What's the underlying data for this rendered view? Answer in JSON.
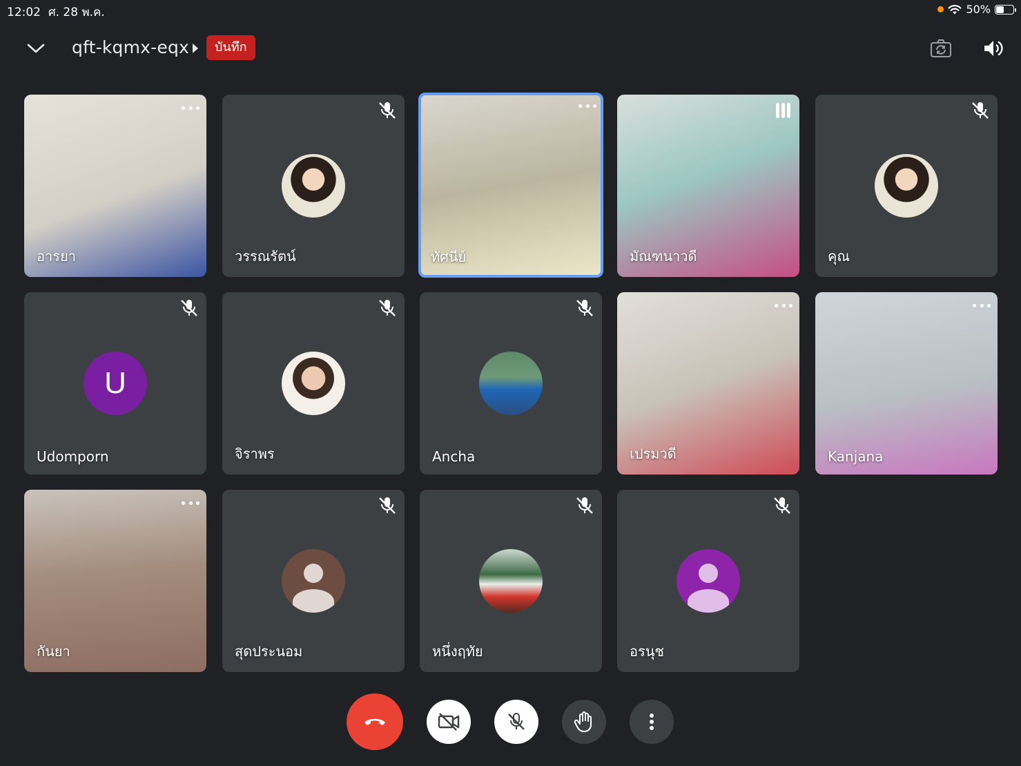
{
  "status": {
    "time": "12:02",
    "date": "ศ. 28 พ.ค.",
    "battery": "50%",
    "battery_level": 0.5
  },
  "header": {
    "meeting_code": "qft-kqmx-eqx",
    "recording_label": "บันทึก",
    "icons": [
      "chevron-down-icon",
      "caret-right-icon",
      "switch-camera-icon",
      "speaker-icon"
    ]
  },
  "participants": [
    {
      "name": "อารยา",
      "indicator": "more",
      "video": true,
      "bg": "#c9c4bc"
    },
    {
      "name": "วรรณรัตน์",
      "indicator": "muted",
      "video": false,
      "avatar": "photo"
    },
    {
      "name": "ทัศนีย์",
      "indicator": "more",
      "video": true,
      "active_speaker": true,
      "bg": "#b9b39f"
    },
    {
      "name": "มัณฑนาวดี",
      "indicator": "speaking",
      "video": true,
      "bg": "#a9b9b4"
    },
    {
      "name": "คุณ",
      "indicator": "muted",
      "video": false,
      "avatar": "photo"
    },
    {
      "name": "Udomporn",
      "indicator": "muted",
      "video": false,
      "avatar_letter": "U",
      "avatar_color": "#7b1fa2"
    },
    {
      "name": "จิราพร",
      "indicator": "muted",
      "video": false,
      "avatar": "photo"
    },
    {
      "name": "Ancha",
      "indicator": "muted",
      "video": false,
      "avatar": "photo"
    },
    {
      "name": "เปรมวดี",
      "indicator": "more",
      "video": true,
      "bg": "#c7c2bb"
    },
    {
      "name": "Kanjana",
      "indicator": "more",
      "video": true,
      "bg": "#bcc3c8"
    },
    {
      "name": "กันยา",
      "indicator": "more",
      "video": true,
      "bg": "#a8988b"
    },
    {
      "name": "สุดประนอม",
      "indicator": "muted",
      "video": false,
      "avatar": "person",
      "avatar_color": "#6d4c41"
    },
    {
      "name": "หนึ่งฤทัย",
      "indicator": "muted",
      "video": false,
      "avatar": "photo"
    },
    {
      "name": "อรนุช",
      "indicator": "muted",
      "video": false,
      "avatar": "person",
      "avatar_color": "#8e24aa"
    }
  ],
  "controls": [
    "end-call-icon",
    "camera-off-icon",
    "mic-off-icon",
    "raise-hand-icon",
    "more-vert-icon"
  ]
}
